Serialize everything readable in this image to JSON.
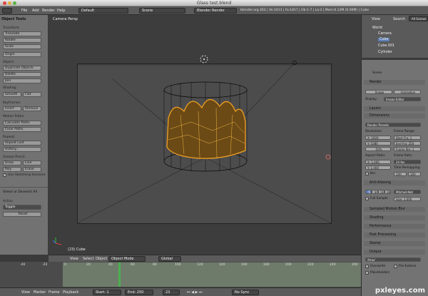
{
  "window": {
    "title": "Glass test.blend"
  },
  "infobar": {
    "menus": [
      "File",
      "Add",
      "Render",
      "Help"
    ],
    "layout": "Default",
    "scene": "Scene",
    "engine": "Blender Render",
    "stats": "blender.org 262 | Ve:1013 | Fa:1817 | Ob:1-7 | La:2 | Mem:6.12M (0.00M) | Cube"
  },
  "toolshelf": {
    "title": "Object Tools",
    "transform": {
      "label": "Transform:",
      "buttons": [
        "Translate",
        "Rotate",
        "Scale"
      ],
      "origin": "Origin"
    },
    "object": {
      "label": "Object:",
      "buttons": [
        "Duplicate Objects",
        "Delete",
        "Join"
      ]
    },
    "shading": {
      "label": "Shading:",
      "smooth": "Smooth",
      "flat": "Flat"
    },
    "keyframes": {
      "label": "Keyframes:",
      "insert": "Insert",
      "remove": "Remove"
    },
    "motion": {
      "label": "Motion Paths:",
      "calc": "Calculate Paths",
      "clear": "Clear Paths"
    },
    "repeat": {
      "label": "Repeat:",
      "last": "Repeat Last",
      "history": "History..."
    },
    "grease": {
      "label": "Grease Pencil:",
      "draw": "Draw",
      "line": "Line",
      "poly": "Poly",
      "erase": "Erase",
      "sketch": "Use Sketching Sessions"
    },
    "select_label": "Select or Deselect All",
    "action_label": "Action",
    "action_value": "Toggle",
    "reset": "Reset"
  },
  "viewport": {
    "camera_label": "Camera Persp",
    "object_label": "(23) Cube",
    "header": {
      "view": "View",
      "select": "Select",
      "object": "Object",
      "mode": "Object Mode",
      "pivot": "Global"
    }
  },
  "timeline": {
    "ticks": [
      "-40",
      "-20",
      "0",
      "20",
      "40",
      "60",
      "80",
      "100",
      "120",
      "140",
      "160",
      "180",
      "200",
      "220",
      "240",
      "260"
    ],
    "menus": [
      "View",
      "Marker",
      "Frame",
      "Playback"
    ],
    "start": "Start: 1",
    "end": "End: 250",
    "current": "23",
    "sync": "No Sync"
  },
  "outliner": {
    "view": "View",
    "search": "Search",
    "scenes": "All Scenes",
    "items": [
      "World",
      "Camera",
      "Cube",
      "Cube.001",
      "Cylinder"
    ]
  },
  "properties": {
    "scene_label": "Scene",
    "render": {
      "title": "Render",
      "image": "Image",
      "animation": "Animation",
      "display_label": "Display:",
      "display_value": "Image Editor"
    },
    "layers": "Layers",
    "dimensions": {
      "title": "Dimensions",
      "presets": "Render Presets",
      "res_label": "Resolution:",
      "res_x": "X: 1920",
      "res_y": "Y: 1080",
      "res_pct": "50%",
      "frame_label": "Frame Range:",
      "start": "Start Fra: 1",
      "end": "End Fra: 250",
      "step": "Frame Ste: 1",
      "aspect_label": "Aspect Ratio:",
      "asp_x": "X: 1.000",
      "asp_y": "Y: 1.000",
      "rate_label": "Frame Rate:",
      "fps": "24 fps",
      "remap_label": "Time Remapping:",
      "remap_old": "100",
      "remap_new": "100",
      "border": "Bor"
    },
    "aa": {
      "title": "Anti-Aliasing",
      "s5": "5",
      "s8": "8",
      "s11": "11",
      "s16": "16",
      "filter": "Mitchell-Net",
      "full": "Full Sample",
      "size": "Size: 1.000"
    },
    "sections": [
      "Sampled Motion Blur",
      "Shading",
      "Performance",
      "Post Processing",
      "Stamp"
    ],
    "output": {
      "title": "Output",
      "path": "/tmp/",
      "overwrite": "Overwrite",
      "ext": "File Extensi",
      "placeholders": "Placeholders"
    }
  },
  "watermark": "pxleyes.com",
  "colors": {
    "accent": "#f0a020",
    "wire": "#0a0a0a"
  }
}
